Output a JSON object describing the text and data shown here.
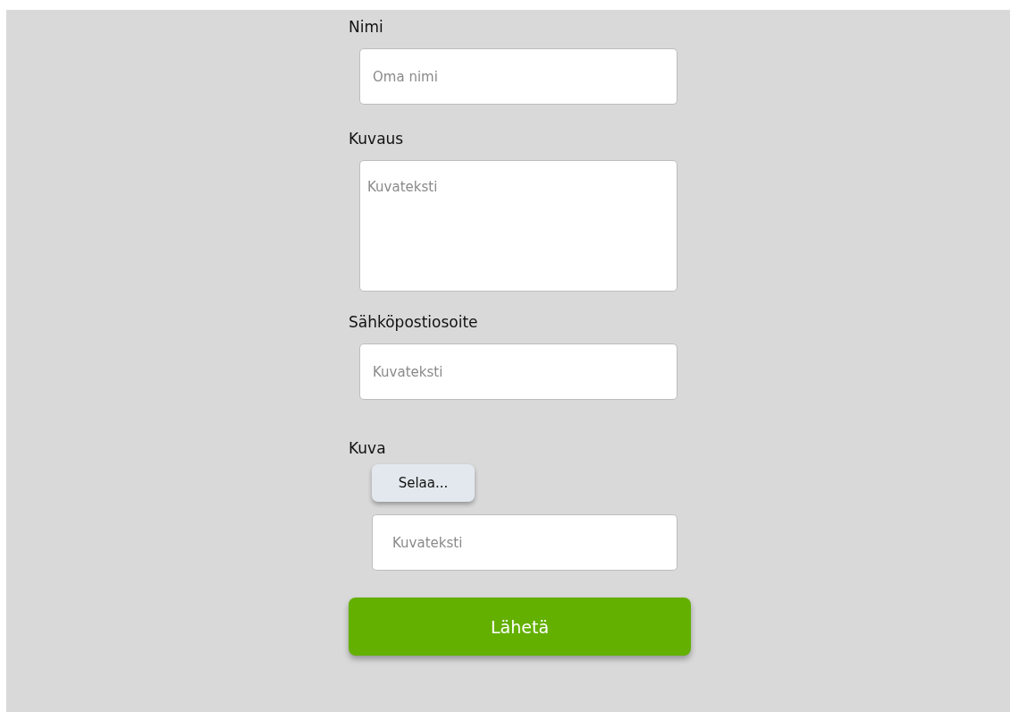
{
  "fields": [
    {
      "label": "Nimi",
      "kind": "input",
      "placeholder": "Oma nimi"
    },
    {
      "label": "Kuvaus",
      "kind": "textarea",
      "placeholder": "Kuvateksti"
    },
    {
      "label": "Sähköpostiosoite",
      "kind": "input",
      "placeholder": "Kuvateksti"
    },
    {
      "label": "Kuva",
      "kind": "file",
      "button": "Selaa...",
      "placeholder": "Kuvateksti"
    }
  ],
  "submit": "Lähetä"
}
